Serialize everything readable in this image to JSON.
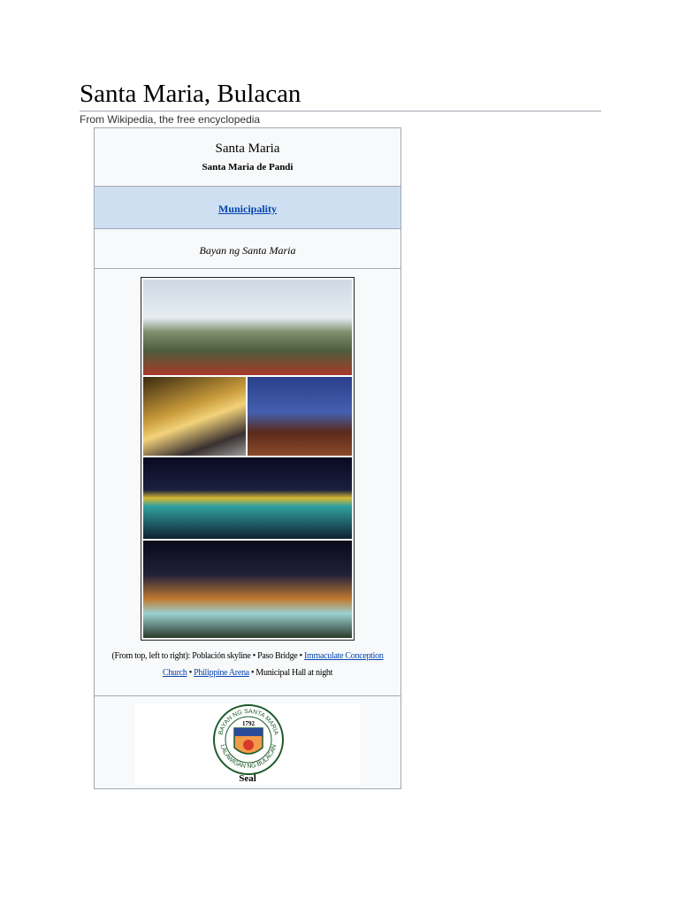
{
  "page": {
    "title": "Santa Maria, Bulacan",
    "subtitle": "From Wikipedia, the free encyclopedia"
  },
  "infobox": {
    "name": "Santa Maria",
    "native_name": "Santa Maria de Pandi",
    "type_link": "Municipality",
    "official_name": "Bayan ng Santa Maria",
    "caption": {
      "prefix": "(From top, left to right): Población skyline • Paso Bridge •",
      "link1": "Immaculate Conception Church",
      "sep": "•",
      "link2": "Philippine Arena",
      "suffix": "• Municipal Hall at night"
    },
    "seal": {
      "label": "Seal",
      "top_text": "BAYAN NG SANTA MARIA",
      "year": "1792",
      "bottom_text": "LALAWIGAN NG BULACAN"
    },
    "colors": {
      "type_band": "#cedff2",
      "link": "#0645ad",
      "border": "#a2a9b1"
    }
  }
}
